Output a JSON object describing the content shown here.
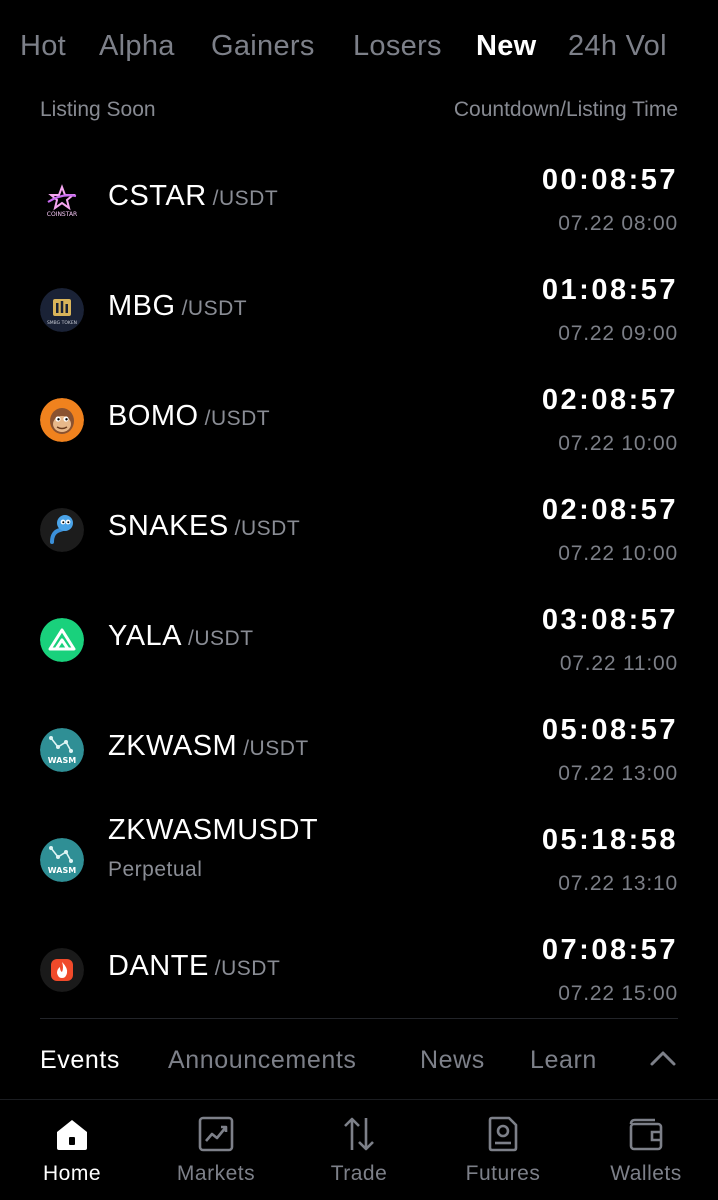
{
  "market_tabs": [
    "Hot",
    "Alpha",
    "Gainers",
    "Losers",
    "New",
    "24h Vol"
  ],
  "active_market_tab": "New",
  "list_header": {
    "left": "Listing Soon",
    "right": "Countdown/Listing Time"
  },
  "listings": [
    {
      "symbol": "CSTAR",
      "quote": "/USDT",
      "subtitle": "",
      "countdown": "00:08:57",
      "listing_time": "07.22 08:00",
      "icon": "coinstar-logo",
      "logo_text": "COINSTAR"
    },
    {
      "symbol": "MBG",
      "quote": "/USDT",
      "subtitle": "",
      "countdown": "01:08:57",
      "listing_time": "07.22 09:00",
      "icon": "mbg-logo",
      "logo_text": "SMBG TOKEN"
    },
    {
      "symbol": "BOMO",
      "quote": "/USDT",
      "subtitle": "",
      "countdown": "02:08:57",
      "listing_time": "07.22 10:00",
      "icon": "bomo-monkey-logo"
    },
    {
      "symbol": "SNAKES",
      "quote": "/USDT",
      "subtitle": "",
      "countdown": "02:08:57",
      "listing_time": "07.22 10:00",
      "icon": "snakes-logo"
    },
    {
      "symbol": "YALA",
      "quote": "/USDT",
      "subtitle": "",
      "countdown": "03:08:57",
      "listing_time": "07.22 11:00",
      "icon": "yala-logo"
    },
    {
      "symbol": "ZKWASM",
      "quote": "/USDT",
      "subtitle": "",
      "countdown": "05:08:57",
      "listing_time": "07.22 13:00",
      "icon": "zkwasm-logo",
      "logo_text": "WASM"
    },
    {
      "symbol": "ZKWASMUSDT",
      "quote": "",
      "subtitle": "Perpetual",
      "countdown": "05:18:58",
      "listing_time": "07.22 13:10",
      "icon": "zkwasm-logo",
      "logo_text": "WASM"
    },
    {
      "symbol": "DANTE",
      "quote": "/USDT",
      "subtitle": "",
      "countdown": "07:08:57",
      "listing_time": "07.22 15:00",
      "icon": "dante-logo"
    }
  ],
  "info_tabs": [
    "Events",
    "Announcements",
    "News",
    "Learn"
  ],
  "active_info_tab": "Events",
  "collapse_icon": "chevron-up-icon",
  "bottom_nav": [
    {
      "label": "Home",
      "icon": "home-icon",
      "active": true
    },
    {
      "label": "Markets",
      "icon": "chart-icon",
      "active": false
    },
    {
      "label": "Trade",
      "icon": "swap-arrows-icon",
      "active": false
    },
    {
      "label": "Futures",
      "icon": "futures-doc-icon",
      "active": false
    },
    {
      "label": "Wallets",
      "icon": "wallet-icon",
      "active": false
    }
  ],
  "colors": {
    "background": "#000000",
    "inactive_text": "#7d8089",
    "active_text": "#ffffff",
    "bomo_orange": "#f0821e",
    "yala_green": "#19d17c",
    "zkwasm_teal": "#2f8f95",
    "dante_red": "#f04a2a"
  }
}
